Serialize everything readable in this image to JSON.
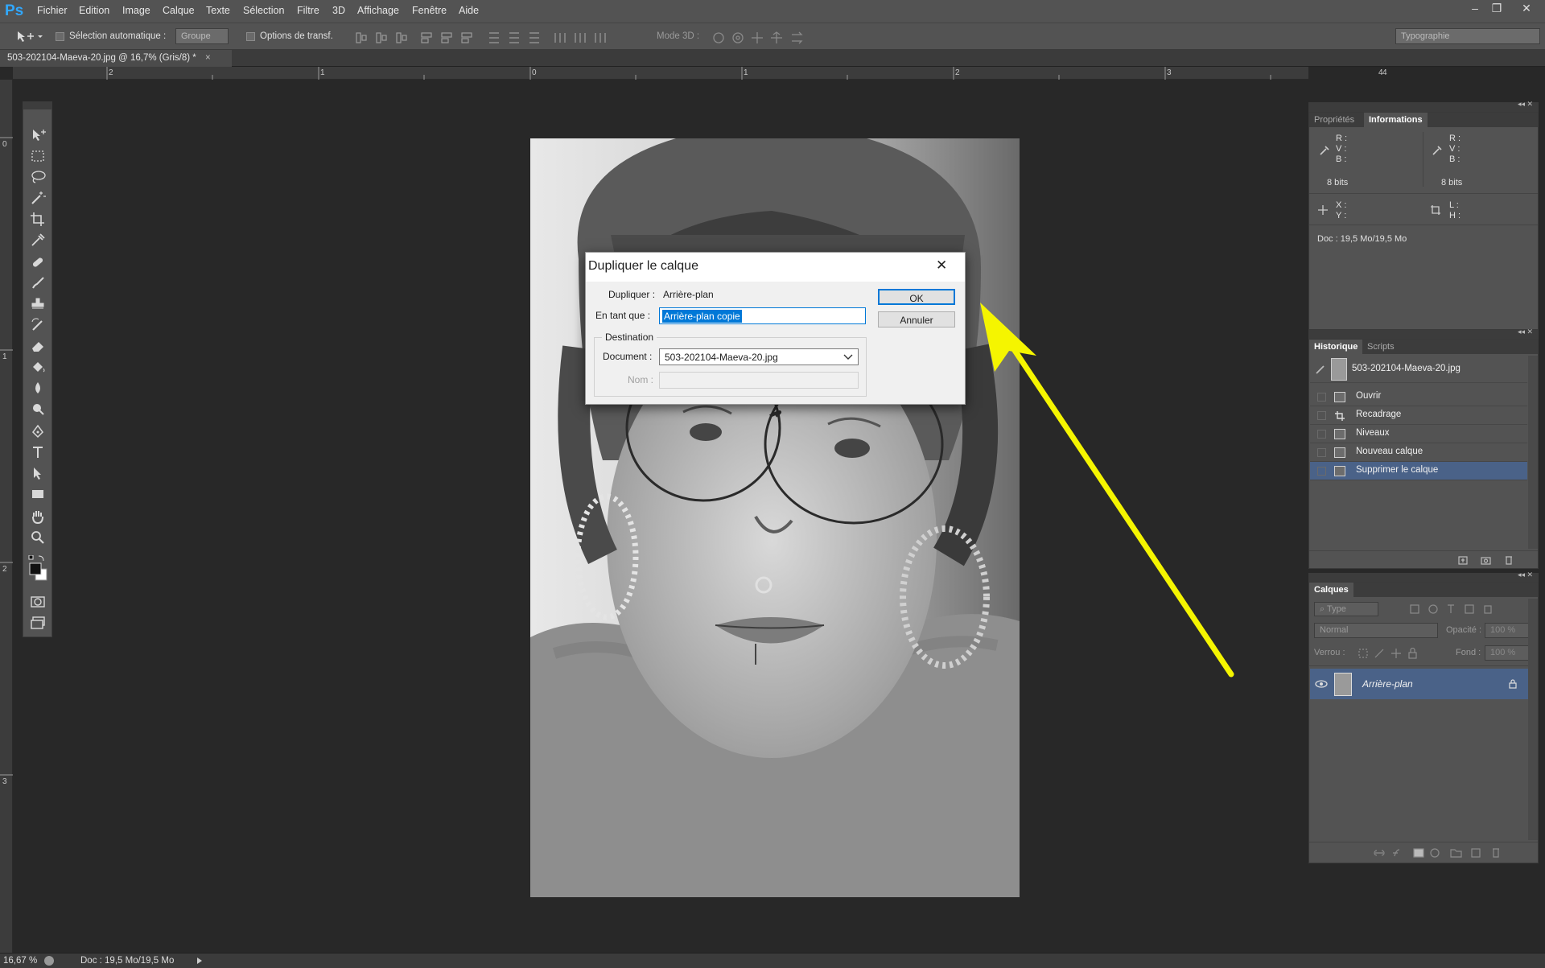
{
  "app": {
    "logo": "Ps"
  },
  "menu": [
    "Fichier",
    "Edition",
    "Image",
    "Calque",
    "Texte",
    "Sélection",
    "Filtre",
    "3D",
    "Affichage",
    "Fenêtre",
    "Aide"
  ],
  "window_controls": {
    "minimize": "–",
    "restore": "❐",
    "close": "✕"
  },
  "options": {
    "auto_select_label": "Sélection automatique :",
    "auto_select_value": "Groupe",
    "transform_label": "Options de transf.",
    "mode3d_label": "Mode 3D :",
    "workspace": "Typographie"
  },
  "document_tab": {
    "title": "503-202104-Maeva-20.jpg @ 16,7% (Gris/8) *",
    "close": "×"
  },
  "rulers": {
    "horizontal": [
      "2",
      "1",
      "0",
      "1",
      "2",
      "3",
      "4"
    ],
    "vertical": [
      "0",
      "1",
      "2",
      "3"
    ]
  },
  "dialog": {
    "title": "Dupliquer le calque",
    "close": "✕",
    "duplicate_label": "Dupliquer :",
    "duplicate_value": "Arrière-plan",
    "as_label": "En tant que :",
    "as_value": "Arrière-plan copie",
    "destination_legend": "Destination",
    "document_label": "Document :",
    "document_value": "503-202104-Maeva-20.jpg",
    "name_label": "Nom :",
    "ok_label": "OK",
    "cancel_label": "Annuler"
  },
  "info_panel": {
    "tabs": [
      "Propriétés",
      "Informations"
    ],
    "active_tab": "Informations",
    "rgb_left": [
      "R :",
      "V :",
      "B :"
    ],
    "rgb_right": [
      "R :",
      "V :",
      "B :"
    ],
    "bits_left": "8 bits",
    "bits_right": "8 bits",
    "xy": [
      "X :",
      "Y :"
    ],
    "lh": [
      "L :",
      "H :"
    ],
    "doc": "Doc : 19,5 Mo/19,5 Mo"
  },
  "history_panel": {
    "tabs": [
      "Historique",
      "Scripts"
    ],
    "snapshot": "503-202104-Maeva-20.jpg",
    "items": [
      "Ouvrir",
      "Recadrage",
      "Niveaux",
      "Nouveau calque",
      "Supprimer le calque"
    ],
    "selected": "Supprimer le calque"
  },
  "layers_panel": {
    "tab": "Calques",
    "filter": "Type",
    "blend_mode": "Normal",
    "opacity_label": "Opacité :",
    "opacity_value": "100 %",
    "lock_label": "Verrou :",
    "fill_label": "Fond :",
    "fill_value": "100 %",
    "layer_name": "Arrière-plan"
  },
  "status": {
    "zoom": "16,67 %",
    "doc": "Doc : 19,5 Mo/19,5 Mo"
  },
  "colors": {
    "accent": "#31a8ff",
    "selection": "#4a6288",
    "annotation_arrow": "#f5f500"
  }
}
